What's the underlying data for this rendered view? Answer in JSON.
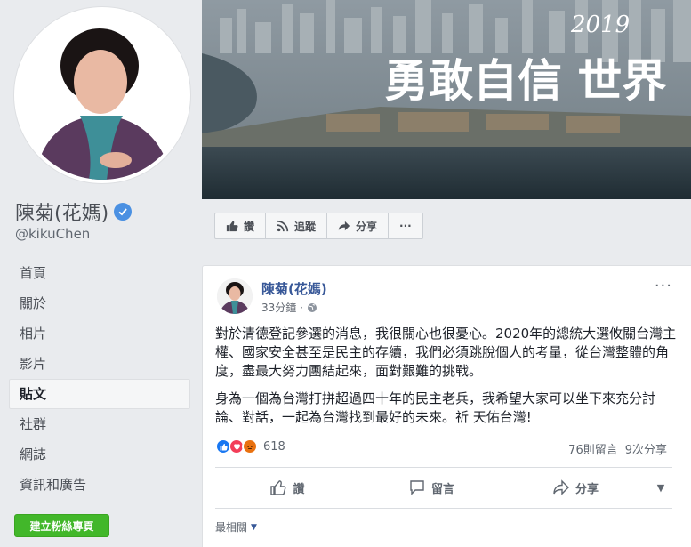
{
  "profile": {
    "name": "陳菊(花媽)",
    "handle": "@kikuChen"
  },
  "nav": {
    "items": [
      {
        "label": "首頁"
      },
      {
        "label": "關於"
      },
      {
        "label": "相片"
      },
      {
        "label": "影片"
      },
      {
        "label": "貼文"
      },
      {
        "label": "社群"
      },
      {
        "label": "網誌"
      },
      {
        "label": "資訊和廣告"
      }
    ],
    "active_index": 4
  },
  "create_page_button": "建立粉絲專頁",
  "cover": {
    "year": "2019",
    "slogan": "勇敢自信 世界"
  },
  "page_actions": {
    "like": "讚",
    "follow": "追蹤",
    "share": "分享",
    "more": "···"
  },
  "post": {
    "author": "陳菊(花媽)",
    "time": "33分鐘 ·",
    "more": "···",
    "paragraph1": "對於清德登記參選的消息，我很關心也很憂心。2020年的總統大選攸關台灣主權、國家安全甚至是民主的存續，我們必須跳脫個人的考量，從台灣整體的角度，盡最大努力團結起來，面對艱難的挑戰。",
    "paragraph2": "身為一個為台灣打拼超過四十年的民主老兵，我希望大家可以坐下來充分討論、對話，一起為台灣找到最好的未來。祈 天佑台灣!",
    "reaction_count": "618",
    "comments": "76則留言",
    "shares": "9次分享",
    "actions": {
      "like": "讚",
      "comment": "留言",
      "share": "分享"
    },
    "sort_label": "最相關"
  },
  "colors": {
    "link_blue": "#385898",
    "verified_blue": "#4a90e2",
    "create_green": "#42b72a",
    "like_blue": "#1877f2",
    "love_red": "#f33e58",
    "angry_orange": "#e9710f"
  }
}
